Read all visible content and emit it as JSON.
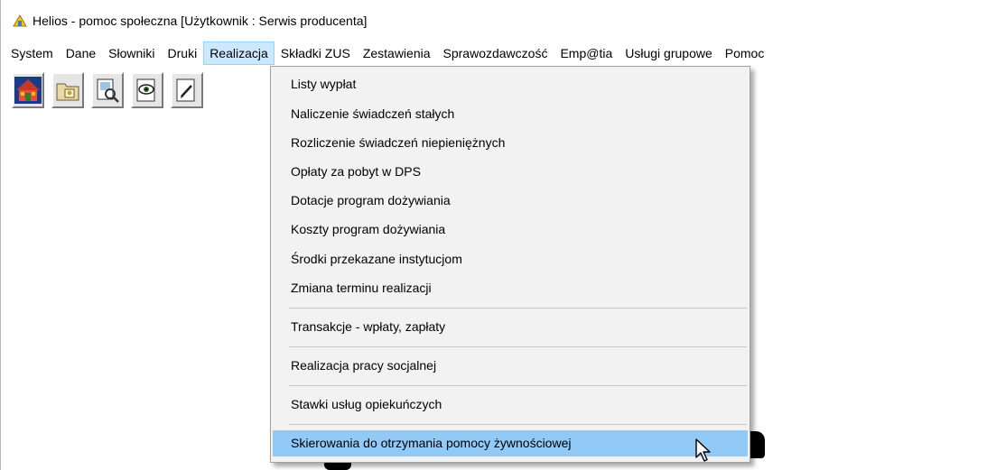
{
  "titlebar": {
    "title": "Helios - pomoc społeczna  [Użytkownik : Serwis producenta]"
  },
  "menubar": {
    "items": [
      {
        "label": "System"
      },
      {
        "label": "Dane"
      },
      {
        "label": "Słowniki"
      },
      {
        "label": "Druki"
      },
      {
        "label": "Realizacja",
        "active": true
      },
      {
        "label": "Składki ZUS"
      },
      {
        "label": "Zestawienia"
      },
      {
        "label": "Sprawozdawczość"
      },
      {
        "label": "Emp@tia"
      },
      {
        "label": "Usługi grupowe"
      },
      {
        "label": "Pomoc"
      }
    ]
  },
  "toolbar": {
    "buttons": [
      {
        "icon": "house-icon"
      },
      {
        "icon": "folder-icon"
      },
      {
        "icon": "document-search-icon"
      },
      {
        "icon": "document-eye-icon"
      },
      {
        "icon": "document-edit-icon"
      }
    ]
  },
  "dropdown": {
    "items": [
      {
        "label": "Listy wypłat"
      },
      {
        "label": "Naliczenie świadczeń stałych"
      },
      {
        "label": "Rozliczenie świadczeń niepieniężnych"
      },
      {
        "label": "Opłaty za pobyt w DPS"
      },
      {
        "label": "Dotacje program dożywiania"
      },
      {
        "label": "Koszty program dożywiania"
      },
      {
        "label": "Środki przekazane instytucjom"
      },
      {
        "label": "Zmiana terminu realizacji"
      },
      {
        "label": "Transakcje - wpłaty, zapłaty"
      },
      {
        "label": "Realizacja pracy socjalnej"
      },
      {
        "label": "Stawki usług opiekuńczych"
      },
      {
        "label": "Skierowania  do otrzymania pomocy żywnościowej",
        "highlighted": true
      }
    ]
  },
  "colors": {
    "menu_active_bg": "#cce8ff",
    "dropdown_bg": "#f2f2f2",
    "highlight_bg": "#91c9f7"
  }
}
